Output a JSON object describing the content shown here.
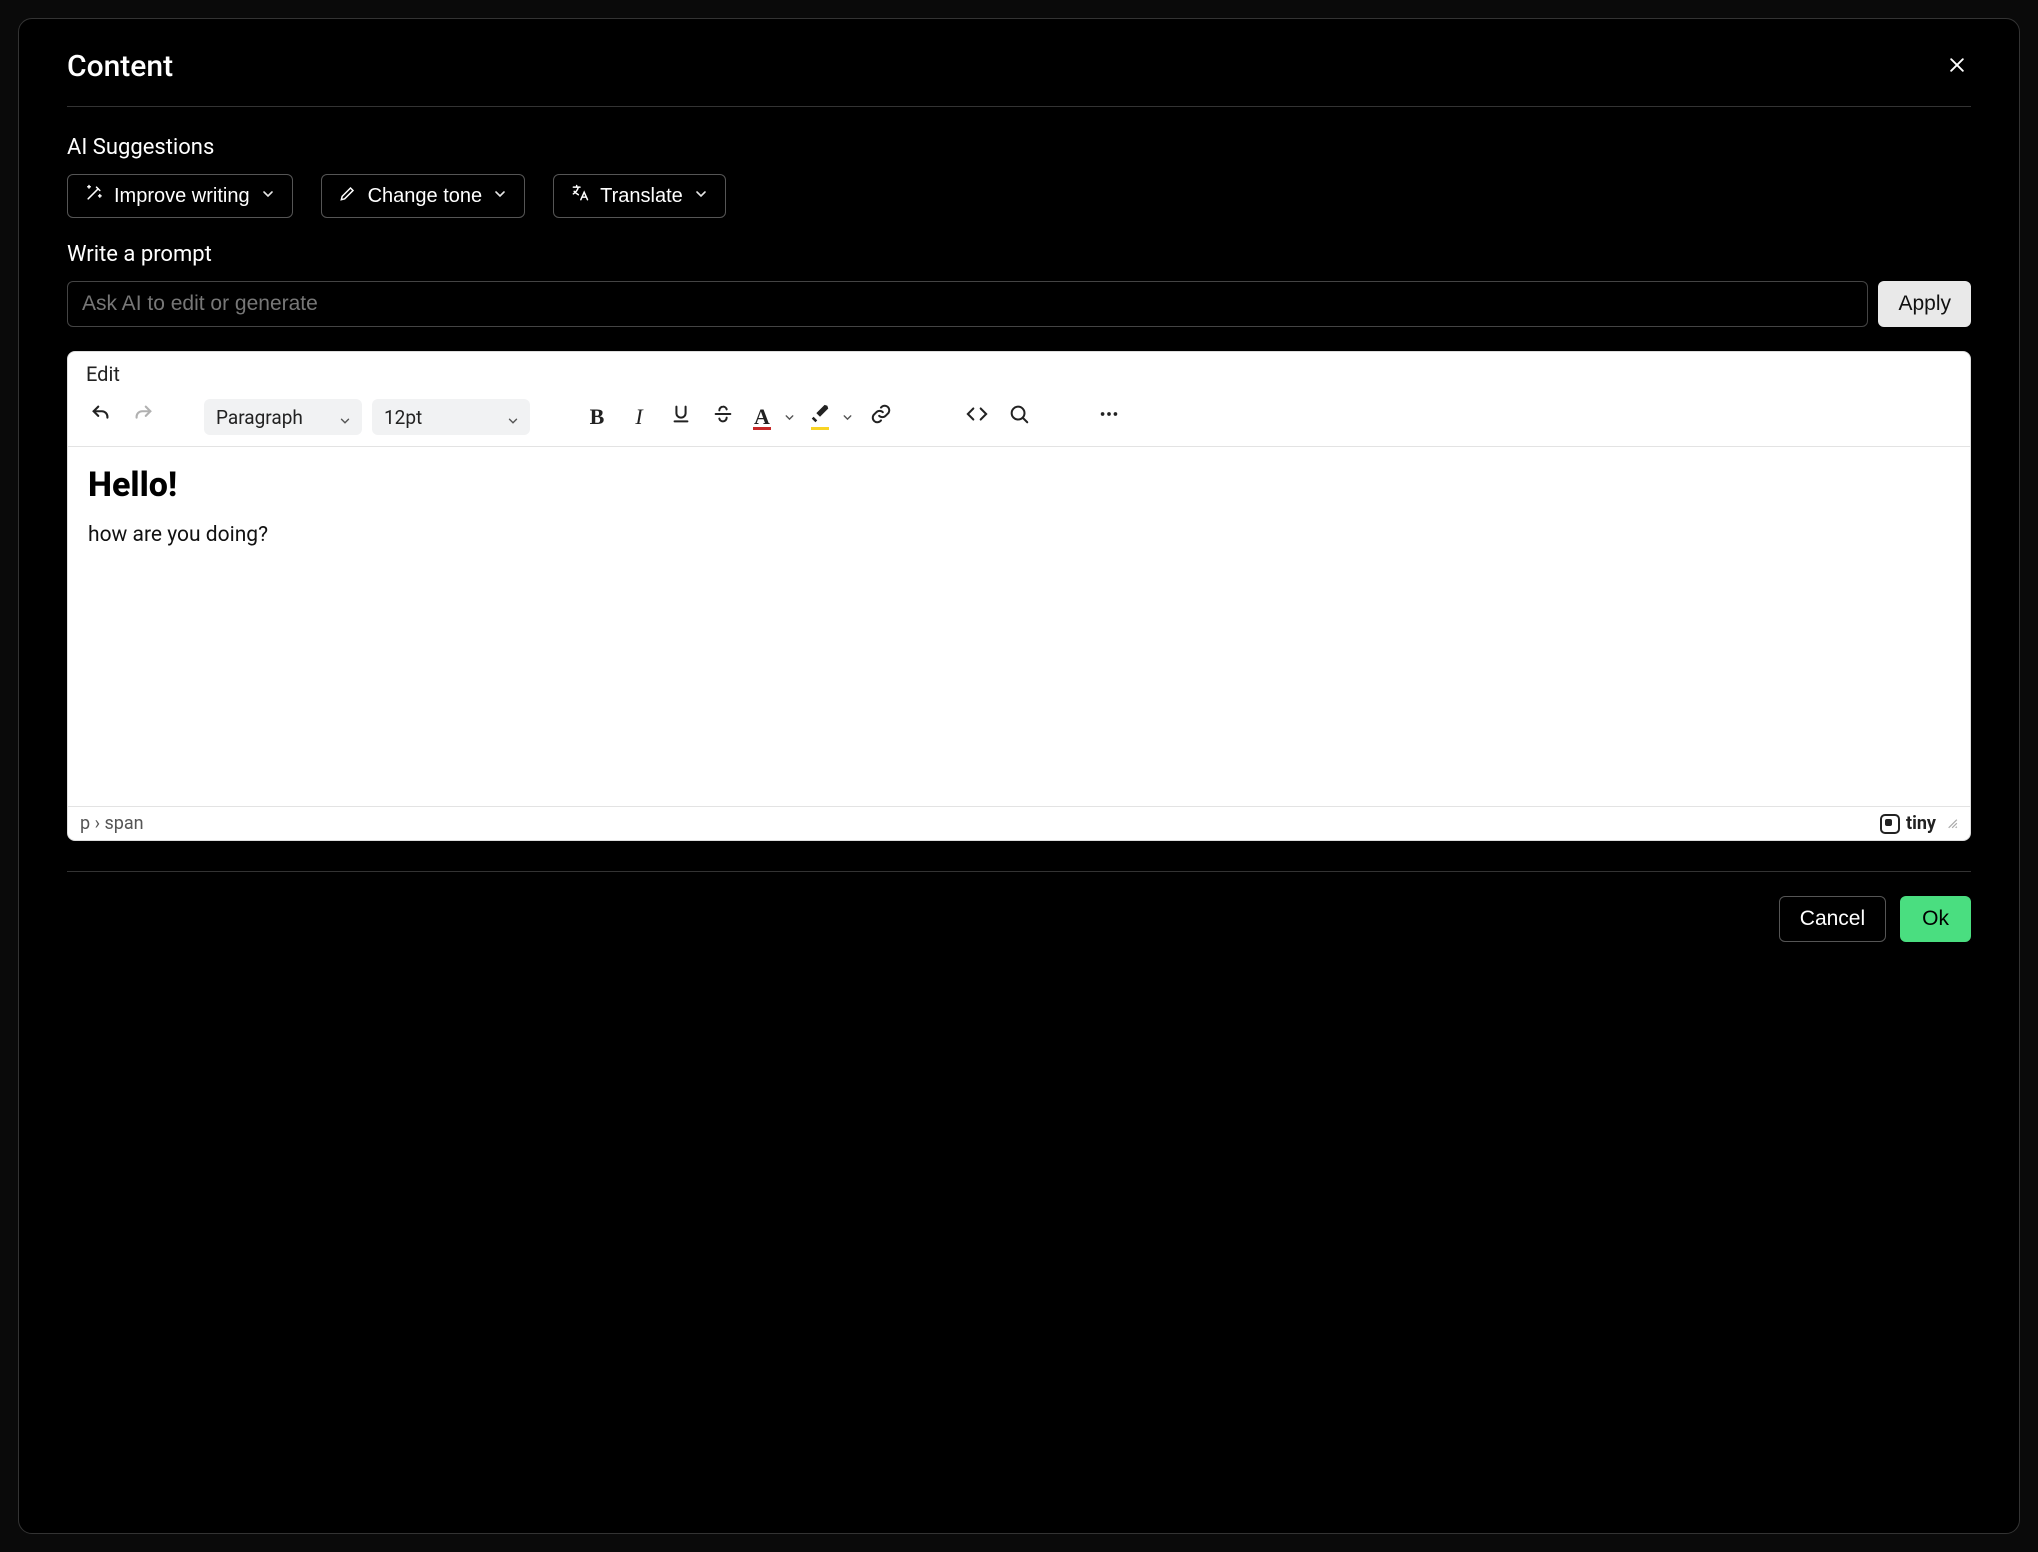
{
  "modal": {
    "title": "Content",
    "ai_section_label": "AI Suggestions",
    "ai_buttons": {
      "improve": "Improve writing",
      "tone": "Change tone",
      "translate": "Translate"
    },
    "prompt_label": "Write a prompt",
    "prompt_placeholder": "Ask AI to edit or generate",
    "apply": "Apply",
    "cancel": "Cancel",
    "ok": "Ok"
  },
  "editor": {
    "menu": {
      "edit": "Edit"
    },
    "block_format": "Paragraph",
    "font_size": "12pt",
    "content": {
      "heading": "Hello!",
      "paragraph": "how are you doing?"
    },
    "statusbar": {
      "path": "p › span",
      "brand": "tiny"
    }
  }
}
